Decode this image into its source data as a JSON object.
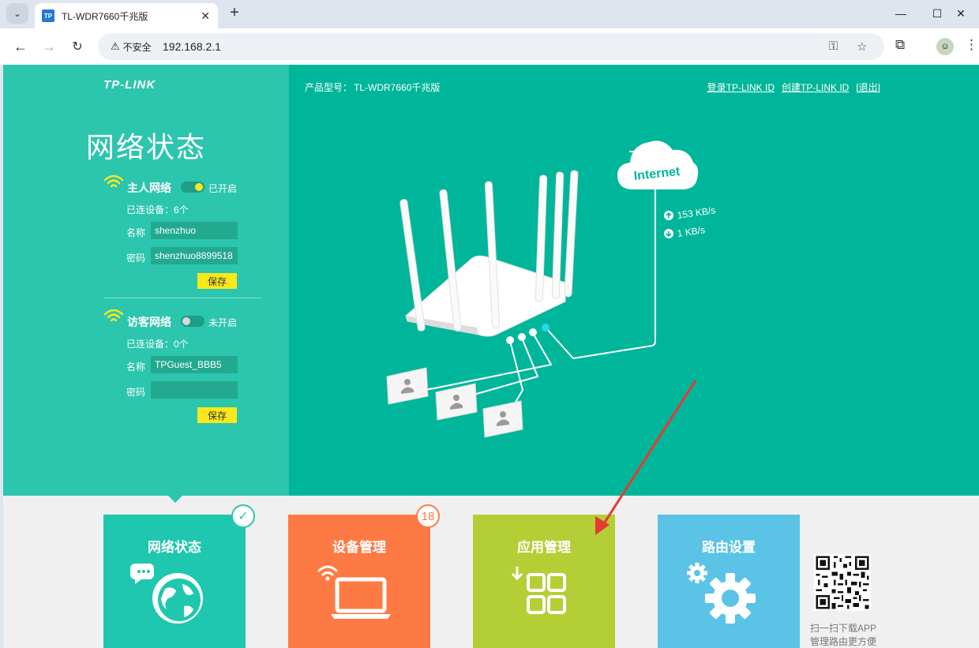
{
  "browser": {
    "tab_title": "TL-WDR7660千兆版",
    "favicon_text": "TP",
    "security_label": "不安全",
    "url": "192.168.2.1"
  },
  "header": {
    "logo": "TP-LINK",
    "model_label": "产品型号：",
    "model_value": "TL-WDR7660千兆版",
    "login_link": "登录TP-LINK ID",
    "create_link": "创建TP-LINK ID",
    "logout_link": "[退出]"
  },
  "sidebar": {
    "heading": "网络状态",
    "host_network": {
      "title": "主人网络",
      "toggle_state": "已开启",
      "devices": "已连设备：6个",
      "name_label": "名称",
      "name_value": "shenzhuo",
      "password_label": "密码",
      "password_value": "shenzhuo8899518",
      "save_label": "保存"
    },
    "guest_network": {
      "title": "访客网络",
      "toggle_state": "未开启",
      "devices": "已连设备：0个",
      "name_label": "名称",
      "name_value": "TPGuest_BBB5",
      "password_label": "密码",
      "password_value": "",
      "save_label": "保存"
    }
  },
  "diagram": {
    "cloud_label": "Internet",
    "upload_speed": "153 KB/s",
    "download_speed": "1 KB/s"
  },
  "tiles": [
    {
      "label": "网络状态",
      "color": "#1ec7ae"
    },
    {
      "label": "设备管理",
      "color": "#fe7a45",
      "badge": "18"
    },
    {
      "label": "应用管理",
      "color": "#b4cf36"
    },
    {
      "label": "路由设置",
      "color": "#5ac3e6"
    }
  ],
  "qr": {
    "line1": "扫一扫下载APP",
    "line2": "管理路由更方便"
  },
  "colors": {
    "left_panel": "#2cc5ae",
    "main_panel": "#00b69a",
    "save_button": "#f8e81c",
    "annotation_arrow": "#e53935"
  }
}
